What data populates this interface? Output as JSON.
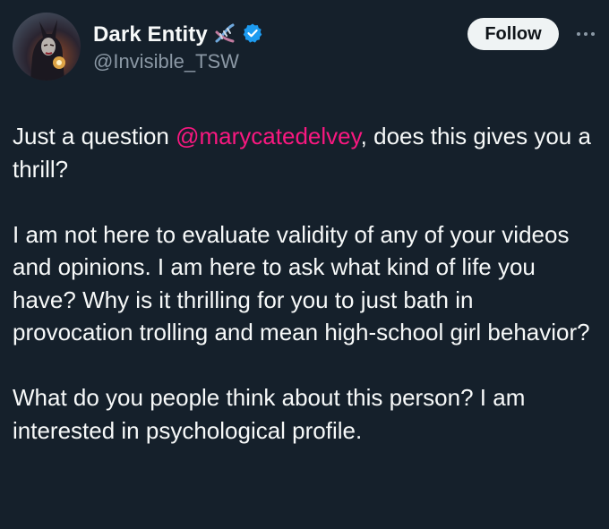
{
  "author": {
    "display_name": "Dark Entity",
    "handle": "@Invisible_TSW",
    "badge_icon": "dna-emoji-icon",
    "verified_icon": "verified-badge-icon"
  },
  "actions": {
    "follow_label": "Follow",
    "more_icon": "more-options-icon"
  },
  "tweet": {
    "p1_prefix": "Just a question ",
    "mention": "@marycatedelvey",
    "p1_suffix": ", does this gives you a thrill?",
    "p2": "I am not here to evaluate validity of any of your videos and opinions. I am here to ask what kind of life you have? Why is it thrilling for you to just bath in provocation trolling and mean high-school girl behavior?",
    "p3": "What do you people think about this  person? I am interested in psychological profile."
  },
  "colors": {
    "background": "#15202b",
    "text": "#f7f9f9",
    "secondary_text": "#8b98a5",
    "mention": "#f91880",
    "verified": "#1d9bf0",
    "follow_bg": "#eff3f4"
  }
}
